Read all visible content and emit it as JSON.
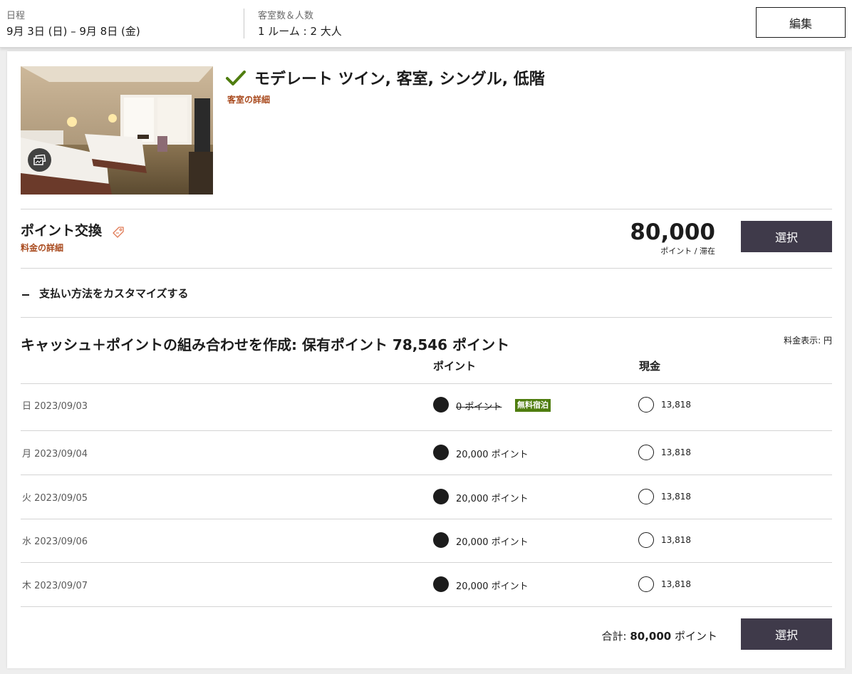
{
  "header": {
    "dates_label": "日程",
    "dates_value": "9月 3日 (日) – 9月 8日 (金)",
    "guests_label": "客室数＆人数",
    "guests_value": "1 ルーム : 2 大人",
    "edit_label": "編集"
  },
  "room": {
    "title": "モデレート ツイン, 客室, シングル, 低階",
    "details_link": "客室の詳細",
    "image_icon": "gallery-icon",
    "check_icon": "checkmark-icon"
  },
  "rate": {
    "title": "ポイント交換",
    "tag_icon": "tag-icon",
    "details_link": "料金の詳細",
    "price": "80,000",
    "price_unit": "ポイント / 滞在",
    "select_label": "選択"
  },
  "customize": {
    "label": "支払い方法をカスタマイズする"
  },
  "combo": {
    "title": "キャッシュ＋ポイントの組み合わせを作成: 保有ポイント 78,546 ポイント",
    "currency_note": "料金表示: 円",
    "col_points": "ポイント",
    "col_cash": "現金",
    "rows": [
      {
        "date": "日 2023/09/03",
        "points": "0 ポイント",
        "badge": "無料宿泊",
        "cash": "13,818"
      },
      {
        "date": "月 2023/09/04",
        "points": "20,000 ポイント",
        "cash": "13,818"
      },
      {
        "date": "火 2023/09/05",
        "points": "20,000 ポイント",
        "cash": "13,818"
      },
      {
        "date": "水 2023/09/06",
        "points": "20,000 ポイント",
        "cash": "13,818"
      },
      {
        "date": "木 2023/09/07",
        "points": "20,000 ポイント",
        "cash": "13,818"
      }
    ],
    "total_label": "合計: ",
    "total_value": "80,000",
    "total_unit": " ポイント",
    "select_label": "選択"
  },
  "colors": {
    "accent_link": "#a94b1f",
    "button": "#3f3a4a",
    "check": "#4f7d0f",
    "badge": "#4f7d0f"
  }
}
